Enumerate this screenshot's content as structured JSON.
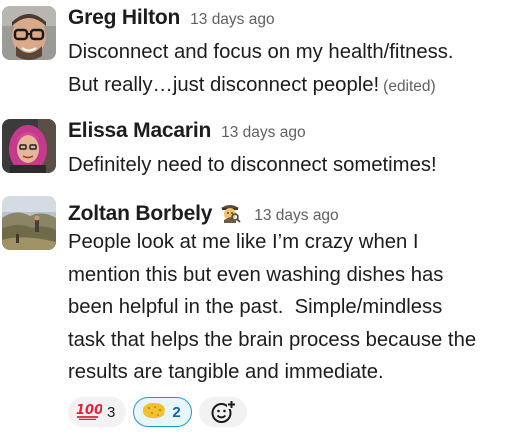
{
  "messages": [
    {
      "author": "Greg Hilton",
      "timestamp": "13 days ago",
      "lines": [
        "Disconnect and focus on my health/fitness.",
        "But really…just disconnect people!"
      ],
      "edited_label": "(edited)"
    },
    {
      "author": "Elissa Macarin",
      "timestamp": "13 days ago",
      "lines": [
        "Definitely need to disconnect sometimes!"
      ]
    },
    {
      "author": "Zoltan Borbely",
      "timestamp": "13 days ago",
      "status_emoji": "detective-emoji",
      "lines": [
        "People look at me like I’m crazy when I",
        "mention this but even washing dishes has",
        "been helpful in the past.  Simple/mindless",
        "task that helps the brain process because the",
        "results are tangible and immediate."
      ],
      "reactions": [
        {
          "emoji": "hundred-points-emoji",
          "count": "3",
          "active": false
        },
        {
          "emoji": "sponge-emoji",
          "count": "2",
          "active": true
        }
      ],
      "add_reaction_icon": "add-reaction-icon"
    }
  ],
  "colors": {
    "text": "#1d1c1d",
    "muted": "#616061",
    "reaction_bg": "#f2f2f2",
    "reaction_active_bg": "#e8f5fa",
    "reaction_active_border": "#1d9bd1",
    "reaction_active_text": "#1264a3"
  }
}
